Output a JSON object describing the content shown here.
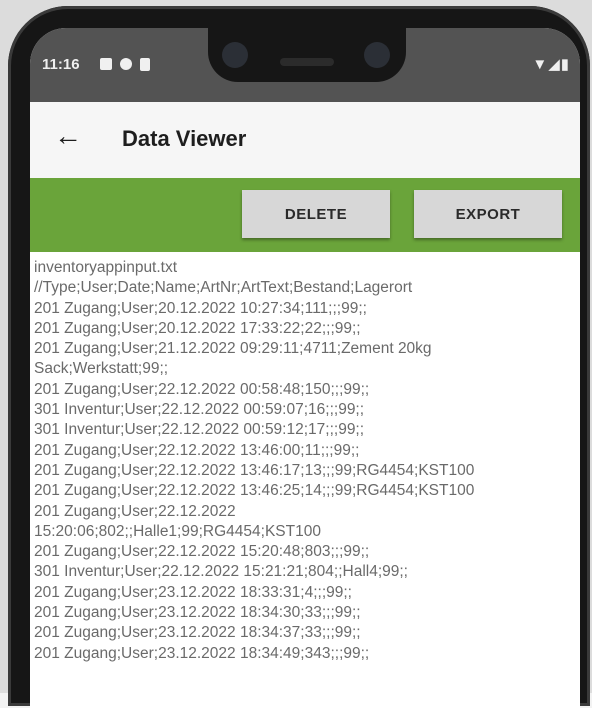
{
  "status": {
    "time": "11:16",
    "right_icons": "▼◢▮"
  },
  "appbar": {
    "title": "Data Viewer"
  },
  "toolbar": {
    "delete_label": "DELETE",
    "export_label": "EXPORT"
  },
  "lines": [
    "inventoryappinput.txt",
    "//Type;User;Date;Name;ArtNr;ArtText;Bestand;Lagerort",
    "201 Zugang;User;20.12.2022 10:27:34;111;;;99;;",
    "201 Zugang;User;20.12.2022 17:33:22;22;;;99;;",
    "201 Zugang;User;21.12.2022 09:29:11;4711;Zement 20kg",
    "Sack;Werkstatt;99;;",
    "201 Zugang;User;22.12.2022 00:58:48;150;;;99;;",
    "301 Inventur;User;22.12.2022 00:59:07;16;;;99;;",
    "301 Inventur;User;22.12.2022 00:59:12;17;;;99;;",
    "201 Zugang;User;22.12.2022 13:46:00;11;;;99;;",
    "201 Zugang;User;22.12.2022 13:46:17;13;;;99;RG4454;KST100",
    "201 Zugang;User;22.12.2022 13:46:25;14;;;99;RG4454;KST100",
    "201 Zugang;User;22.12.2022",
    "15:20:06;802;;Halle1;99;RG4454;KST100",
    "201 Zugang;User;22.12.2022 15:20:48;803;;;99;;",
    "301 Inventur;User;22.12.2022 15:21:21;804;;Hall4;99;;",
    "201 Zugang;User;23.12.2022 18:33:31;4;;;99;;",
    "201 Zugang;User;23.12.2022 18:34:30;33;;;99;;",
    "201 Zugang;User;23.12.2022 18:34:37;33;;;99;;",
    "201 Zugang;User;23.12.2022 18:34:49;343;;;99;;"
  ]
}
